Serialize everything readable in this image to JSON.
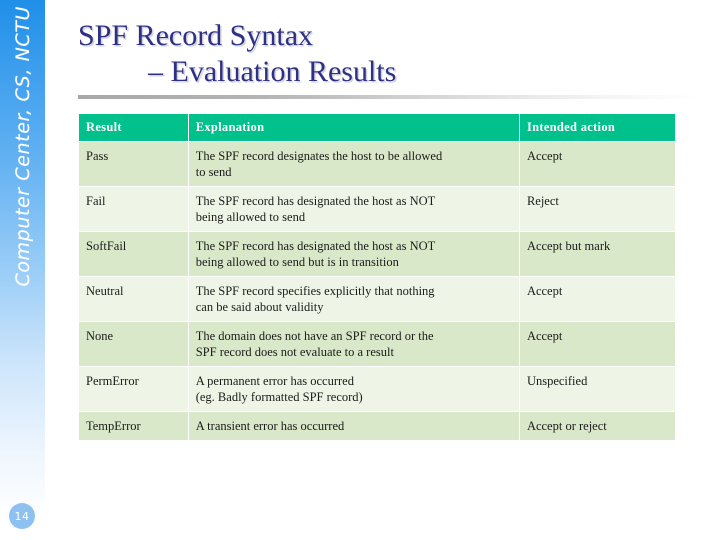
{
  "slide": {
    "sidebar_text": "Computer Center, CS, NCTU",
    "page_number": "14",
    "accent_header_color": "#00c08c",
    "title_color": "#2e3084",
    "row_dark_color": "#d8e8c8",
    "row_light_color": "#eef5e6",
    "sidebar_top_color": "#1f8fe8"
  },
  "title": {
    "line1": "SPF Record Syntax",
    "line2": "– Evaluation Results"
  },
  "table": {
    "headers": [
      "Result",
      "Explanation",
      "Intended action"
    ],
    "rows": [
      {
        "result": "Pass",
        "explanation": "The SPF record designates the host to be allowed\nto send",
        "action": "Accept"
      },
      {
        "result": "Fail",
        "explanation": "The SPF record has designated the host as NOT\nbeing allowed to send",
        "action": "Reject"
      },
      {
        "result": "SoftFail",
        "explanation": "The SPF record has designated the host as NOT\nbeing allowed to send but is in transition",
        "action": "Accept but mark"
      },
      {
        "result": "Neutral",
        "explanation": "The SPF record specifies explicitly that nothing\ncan be said about validity",
        "action": "Accept"
      },
      {
        "result": "None",
        "explanation": "The domain does not have an SPF record or the\nSPF record does not evaluate to a result",
        "action": "Accept"
      },
      {
        "result": "PermError",
        "explanation": "A permanent error has occurred\n(eg. Badly formatted SPF record)",
        "action": "Unspecified"
      },
      {
        "result": "TempError",
        "explanation": "A transient error has occurred",
        "action": "Accept or reject"
      }
    ]
  }
}
